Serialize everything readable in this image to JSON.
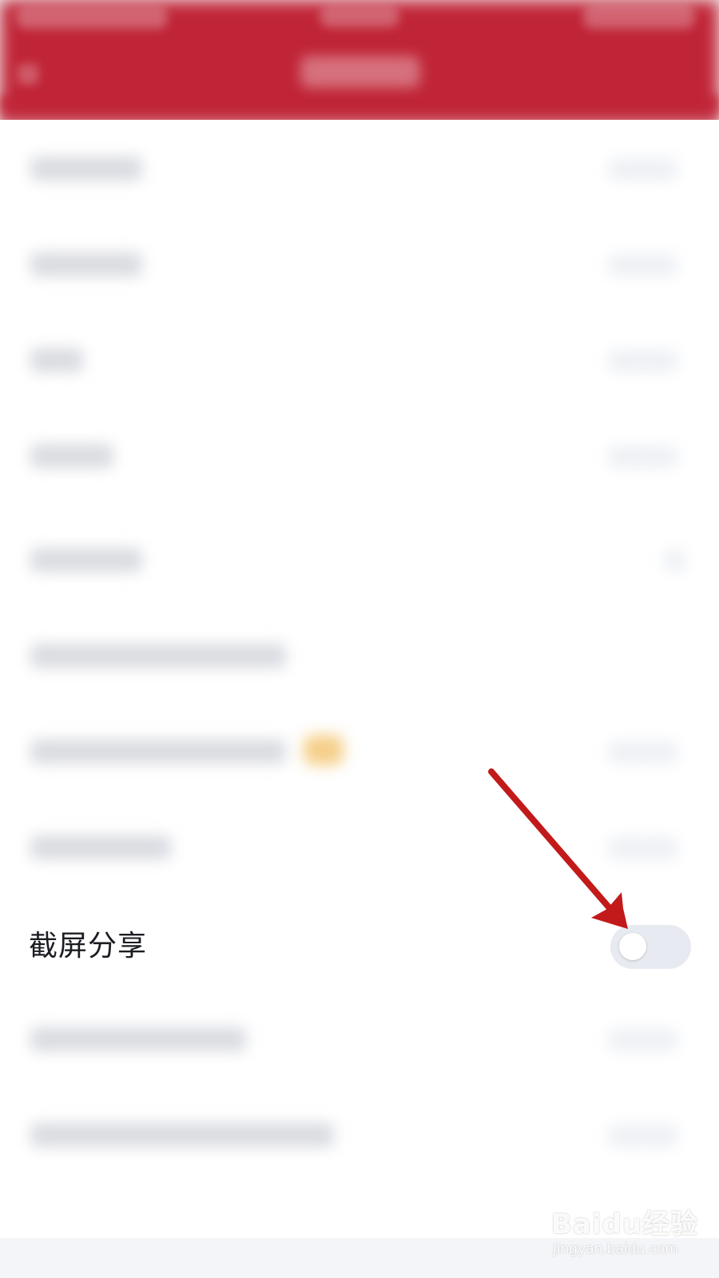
{
  "settings": {
    "screenshot_share": {
      "label": "截屏分享",
      "enabled": false
    }
  },
  "watermark": {
    "brand": "Baidu经验",
    "url": "jingyan.baidu.com"
  },
  "colors": {
    "header": "#c02537",
    "toggle_off_track": "#e8eaf1",
    "annotation_arrow": "#c21a1a"
  }
}
